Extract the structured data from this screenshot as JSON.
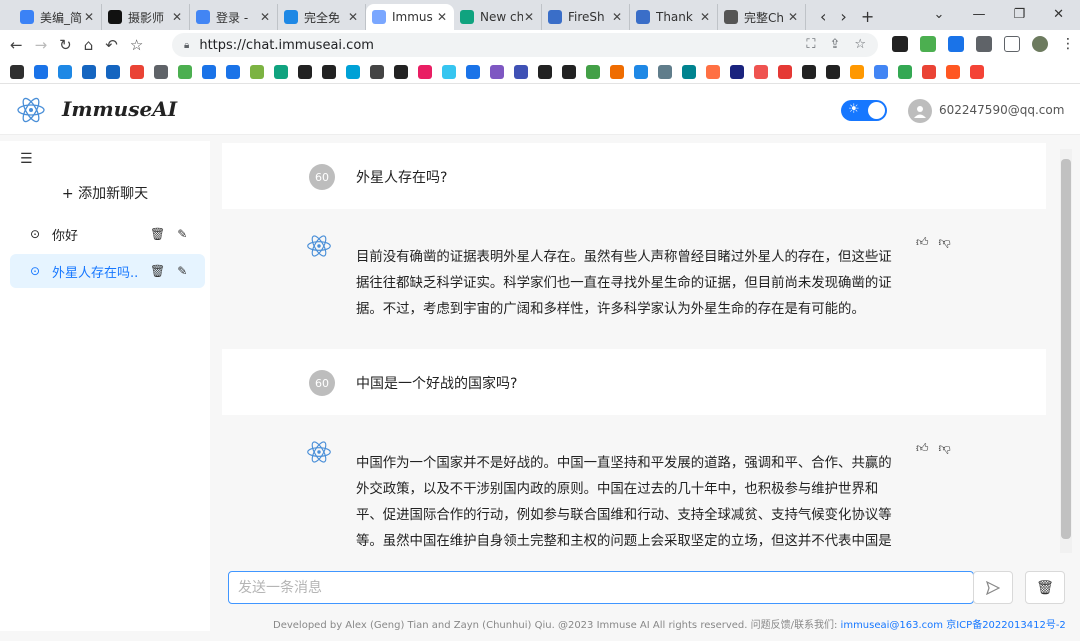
{
  "browser": {
    "tabs": [
      {
        "title": "美编_简",
        "color": "#3b82f6"
      },
      {
        "title": "摄影师",
        "color": "#111111"
      },
      {
        "title": "登录 - ",
        "color": "#4285f4"
      },
      {
        "title": "完全免",
        "color": "#1e88e5"
      },
      {
        "title": "Immus",
        "color": "#7aa7ff",
        "active": true
      },
      {
        "title": "New ch",
        "color": "#10a37f"
      },
      {
        "title": "FireSh",
        "color": "#3a6ec8"
      },
      {
        "title": "Thank",
        "color": "#3a6ec8"
      },
      {
        "title": "完整Ch",
        "color": "#555555"
      }
    ],
    "url": "https://chat.immuseai.com"
  },
  "header": {
    "brand": "ImmuseAI",
    "user_email": "602247590@qq.com",
    "theme_toggle_on": true
  },
  "sidebar": {
    "new_chat_label": "+ 添加新聊天",
    "items": [
      {
        "label": "你好",
        "active": false
      },
      {
        "label": "外星人存在吗...",
        "active": true
      }
    ]
  },
  "chat": {
    "messages": [
      {
        "role": "user",
        "avatar": "60",
        "text": "外星人存在吗?"
      },
      {
        "role": "assistant",
        "text": "目前没有确凿的证据表明外星人存在。虽然有些人声称曾经目睹过外星人的存在，但这些证据往往都缺乏科学证实。科学家们也一直在寻找外星生命的证据，但目前尚未发现确凿的证据。不过，考虑到宇宙的广阔和多样性，许多科学家认为外星生命的存在是有可能的。"
      },
      {
        "role": "user",
        "avatar": "60",
        "text": "中国是一个好战的国家吗?"
      },
      {
        "role": "assistant",
        "text": "中国作为一个国家并不是好战的。中国一直坚持和平发展的道路，强调和平、合作、共赢的外交政策，以及不干涉别国内政的原则。中国在过去的几十年中，也积极参与维护世界和平、促进国际合作的行动，例如参与联合国维和行动、支持全球减贫、支持气候变化协议等等。虽然中国在维护自身领土完整和主权的问题上会采取坚定的立场，但这并不代表中国是一个好战的国家。"
      }
    ]
  },
  "composer": {
    "placeholder": "发送一条消息"
  },
  "footer": {
    "text": "Developed by Alex (Geng) Tian and Zayn (Chunhui) Qiu. @2023 Immuse AI All rights reserved.  问题反馈/联系我们:",
    "email": "immuseai@163.com",
    "icp": "京ICP备2022013412号-2"
  },
  "colors": {
    "accent": "#1677ff",
    "active_bg": "#e6f4ff"
  }
}
